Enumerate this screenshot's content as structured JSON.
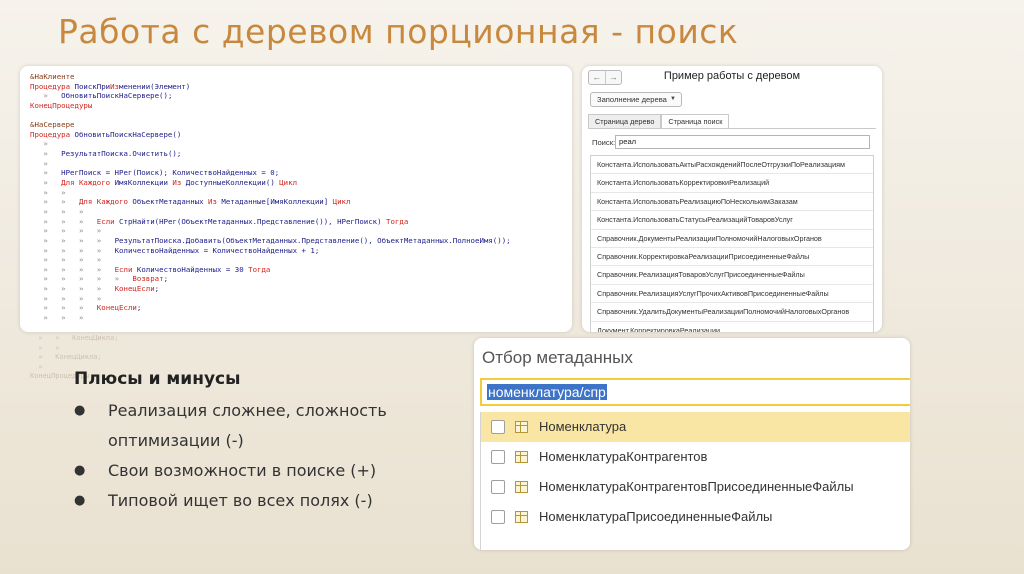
{
  "slide": {
    "title": "Работа с деревом порционная - поиск"
  },
  "code": {
    "lines": [
      "&НаКлиенте",
      "Процедура ПоискПриИзменении(Элемент)",
      "   »   ОбновитьПоискНаСервере();",
      "КонецПроцедуры",
      "",
      "&НаСервере",
      "Процедура ОбновитьПоискНаСервере()",
      "   »",
      "   »   РезультатПоиска.Очистить();",
      "   »",
      "   »   НРегПоиск = НРег(Поиск); КоличествоНайденных = 0;",
      "   »   Для Каждого ИмяКоллекции Из ДоступныеКоллекции() Цикл",
      "   »   »",
      "   »   »   Для Каждого ОбъектМетаданных Из Метаданные[ИмяКоллекции] Цикл",
      "   »   »   »",
      "   »   »   »   Если СтрНайти(НРег(ОбъектМетаданных.Представление()), НРегПоиск) Тогда",
      "   »   »   »   »",
      "   »   »   »   »   РезультатПоиска.Добавить(ОбъектМетаданных.Представление(), ОбъектМетаданных.ПолноеИмя());",
      "   »   »   »   »   КоличествоНайденных = КоличествоНайденных + 1;",
      "   »   »   »   »",
      "   »   »   »   »   Если КоличествоНайденных = 30 Тогда",
      "   »   »   »   »   »   Возврат;",
      "   »   »   »   »   КонецЕсли;",
      "   »   »   »   »",
      "   »   »   »   КонецЕсли;",
      "   »   »   »"
    ],
    "ghost_lines": [
      "  »   »   КонецЦикла;",
      "  »   »",
      "  »   КонецЦикла;",
      "  »",
      "КонецПроцедуры"
    ]
  },
  "tree_example": {
    "title": "Пример работы с деревом",
    "nav_back": "←",
    "nav_forward": "→",
    "fill_button": "Заполнение дерева",
    "tabs": [
      {
        "label": "Страница дерево",
        "active": false
      },
      {
        "label": "Страница поиск",
        "active": true
      }
    ],
    "search_label": "Поиск:",
    "search_value": "реал",
    "results": [
      "Константа.ИспользоватьАктыРасхожденийПослеОтгрузкиПоРеализациям",
      "Константа.ИспользоватьКорректировкиРеализаций",
      "Константа.ИспользоватьРеализациюПоНесколькимЗаказам",
      "Константа.ИспользоватьСтатусыРеализацийТоваровУслуг",
      "Справочник.ДокументыРеализацииПолномочийНалоговыхОрганов",
      "Справочник.КорректировкаРеализацииПрисоединенныеФайлы",
      "Справочник.РеализацияТоваровУслугПрисоединенныеФайлы",
      "Справочник.РеализацияУслугПрочихАктивовПрисоединенныеФайлы",
      "Справочник.УдалитьДокументыРеализацииПолномочийНалоговыхОрганов",
      "Документ.КорректировкаРеализации"
    ]
  },
  "pros_cons": {
    "title": "Плюсы и минусы",
    "bullet_glyph": "●",
    "items": [
      "Реализация сложнее, сложность оптимизации (-)",
      "Свои возможности в поиске (+)",
      "Типовой ищет во всех полях (-)"
    ]
  },
  "metadata_filter": {
    "title": "Отбор метаданных",
    "input_value": "номенклатура/спр",
    "items": [
      {
        "label": "Номенклатура",
        "checked": false,
        "highlighted": true
      },
      {
        "label": "НоменклатураКонтрагентов",
        "checked": false,
        "highlighted": false
      },
      {
        "label": "НоменклатураКонтрагентовПрисоединенныеФайлы",
        "checked": false,
        "highlighted": false
      },
      {
        "label": "НоменклатураПрисоединенныеФайлы",
        "checked": false,
        "highlighted": false
      }
    ]
  },
  "colors": {
    "title": "#c8893f",
    "keyword": "#d0261f",
    "highlight_row": "#f9e6a5",
    "input_border": "#f2cc3b",
    "selection": "#3d74c7"
  }
}
